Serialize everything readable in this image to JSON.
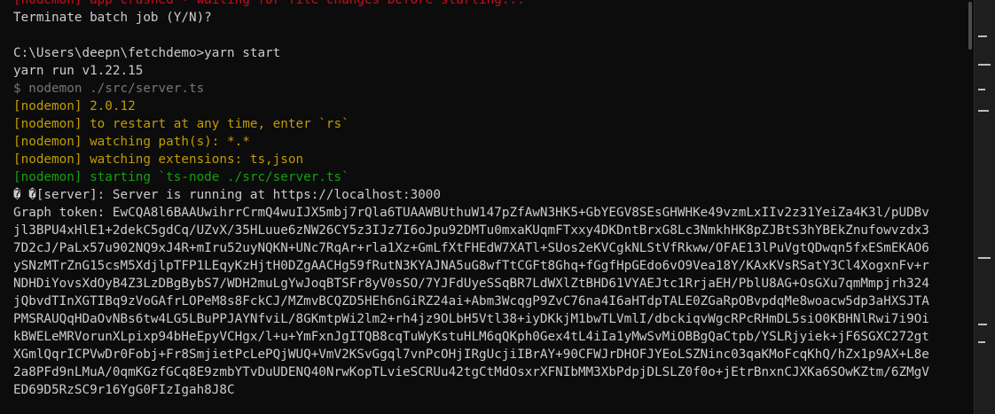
{
  "terminal": {
    "lines": [
      "[nodemon] app crashed - waiting for file changes before starting...",
      "Terminate batch job (Y/N)?",
      "",
      "C:\\Users\\deepn\\fetchdemo>yarn start",
      "yarn run v1.22.15",
      "$ nodemon ./src/server.ts",
      "[nodemon] 2.0.12",
      "[nodemon] to restart at any time, enter `rs`",
      "[nodemon] watching path(s): *.*",
      "[nodemon] watching extensions: ts,json",
      "[nodemon] starting `ts-node ./src/server.ts`",
      "� �[server]: Server is running at https://localhost:3000",
      "Graph token: EwCQA8l6BAAUwihrrCrmQ4wuIJX5mbj7rQla6TUAAWBUthuW147pZfAwN3HK5+GbYEGV8SEsGHWHKe49vzmLxIIv2z31YeiZa4K3l/pUDBv",
      "jl3BPU4xHlE1+2dekC5gdCq/UZvX/35HLuue6zNW26CY5z3IJz7I6oJpu92DMTu0mxaKUqmFTxxy4DKDntBrxG8Lc3NmkhHK8pZJBtS3hYBEkZnufowvzdx3",
      "7D2cJ/PaLx57u902NQ9xJ4R+mIru52uyNQKN+UNc7RqAr+rla1Xz+GmLfXtFHEdW7XATl+SUos2eKVCgkNLStVfRkww/OFAE13lPuVgtQDwqn5fxESmEKAO6",
      "ySNzMTrZnG15csM5XdjlpTFP1LEqyKzHjtH0DZgAACHg59fRutN3KYAJNA5uG8wfTtCGFt8Ghq+fGgfHpGEdo6vO9Vea18Y/KAxKVsRSatY3Cl4XogxnFv+r",
      "NDHDiYovsXdOyB4Z3LzDBgBybS7/WDH2muLgYwJoqBTSFr8yV0sSO/7YJFdUyeSSqBR7LdWXlZtBHD61VYAEJtc1RrjaEH/PblU8AG+OsGXu7qmMmpjrh324",
      "jQbvdTInXGTIBq9zVoGAfrLOPeM8s8FckCJ/MZmvBCQZD5HEh6nGiRZ24ai+Abm3WcqgP9ZvC76na4I6aHTdpTALE0ZGaRpOBvpdqMe8woacw5dp3aHXSJTA",
      "PMSRAUQqHDaOvNBs6tw4LG5LBuPPJAYNfviL/8GKmtpWi2lm2+rh4jz9OLbH5Vtl38+iyDKkjM1bwTLVmlI/dbckiqvWgcRPcRHmDL5siO0KBHNlRwi7i9Oi",
      "kBWELeMRVorunXLpixp94bHeEpyVCHgx/l+u+YmFxnJgITQB8cqTuWyKstuHLM6qQKph0Gex4tL4iIa1yMwSvMiOBBgQaCtpb/YSLRjyiek+jF6SGXC272gt",
      "XGmlQqrICPVwDr0Fobj+Fr8SmjietPcLePQjWUQ+VmV2KSvGgql7vnPcOHjIRgUcjiIBrAY+90CFWJrDHOFJYEoLSZNinc03qaKMoFcqKhQ/hZx1p9AX+L8e",
      "2a8PFd9nLMuA/0qmKGzfGCq8E9zmbYTvDuUDENQ40NrwKopTLvieSCRUu42tgCtMdOsxrXFNIbMM3XbPdpjDLSLZ0f0o+jEtrBnxnCJXKa6SOwKZtm/6ZMgV",
      "ED69D5RzSC9r16YgG0FIzIgah8J8C"
    ],
    "colors": {
      "background": "#0c0c0c",
      "default_text": "#cccccc",
      "nodemon_red": "#c50f1f",
      "nodemon_yellow": "#c19c00",
      "nodemon_green": "#13a10e",
      "command_gray": "#767676"
    }
  }
}
